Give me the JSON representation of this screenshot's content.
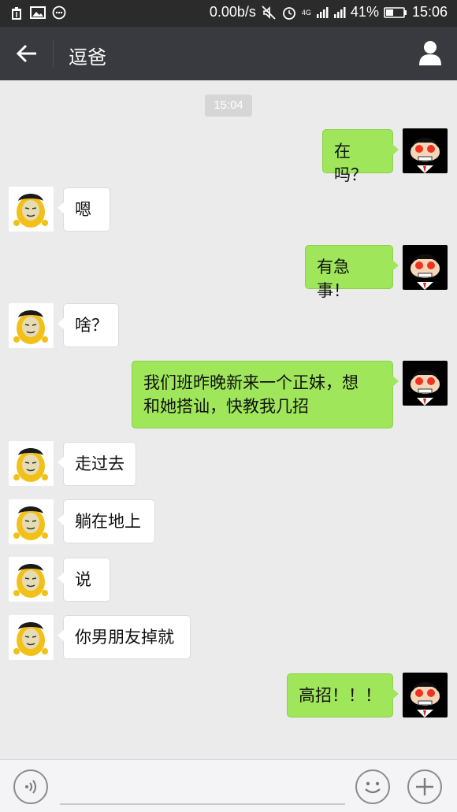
{
  "status_bar": {
    "net_speed": "0.00b/s",
    "network": "4G",
    "battery": "41%",
    "clock": "15:06",
    "icons": [
      "trash-icon",
      "image-icon",
      "chat-bubble-icon",
      "mute-icon",
      "alarm-icon",
      "signal-icon",
      "signal-icon",
      "battery-icon"
    ]
  },
  "header": {
    "title": "逗爸",
    "icons": [
      "back-arrow-icon",
      "person-icon"
    ],
    "color": "#393a3f"
  },
  "chat": {
    "timestamp": "15:04",
    "messages": [
      {
        "side": "right",
        "text": "在吗？"
      },
      {
        "side": "left",
        "text": "嗯"
      },
      {
        "side": "right",
        "text": "有急事！"
      },
      {
        "side": "left",
        "text": "啥？"
      },
      {
        "side": "right",
        "lines": [
          "我们班昨晚新来一个正妹，想",
          "和她搭讪，快教我几招"
        ]
      },
      {
        "side": "left",
        "text": "走过去"
      },
      {
        "side": "left",
        "text": "躺在地上"
      },
      {
        "side": "left",
        "text": "说"
      },
      {
        "side": "left",
        "text": "你男朋友掉就"
      },
      {
        "side": "right",
        "text": "高招！！！"
      }
    ],
    "colors": {
      "right_bubble": "#9fe65a",
      "left_bubble": "#ffffff",
      "background": "#ebebeb"
    }
  },
  "input_bar": {
    "icons": [
      "voice-icon",
      "emoji-icon",
      "plus-icon"
    ]
  }
}
